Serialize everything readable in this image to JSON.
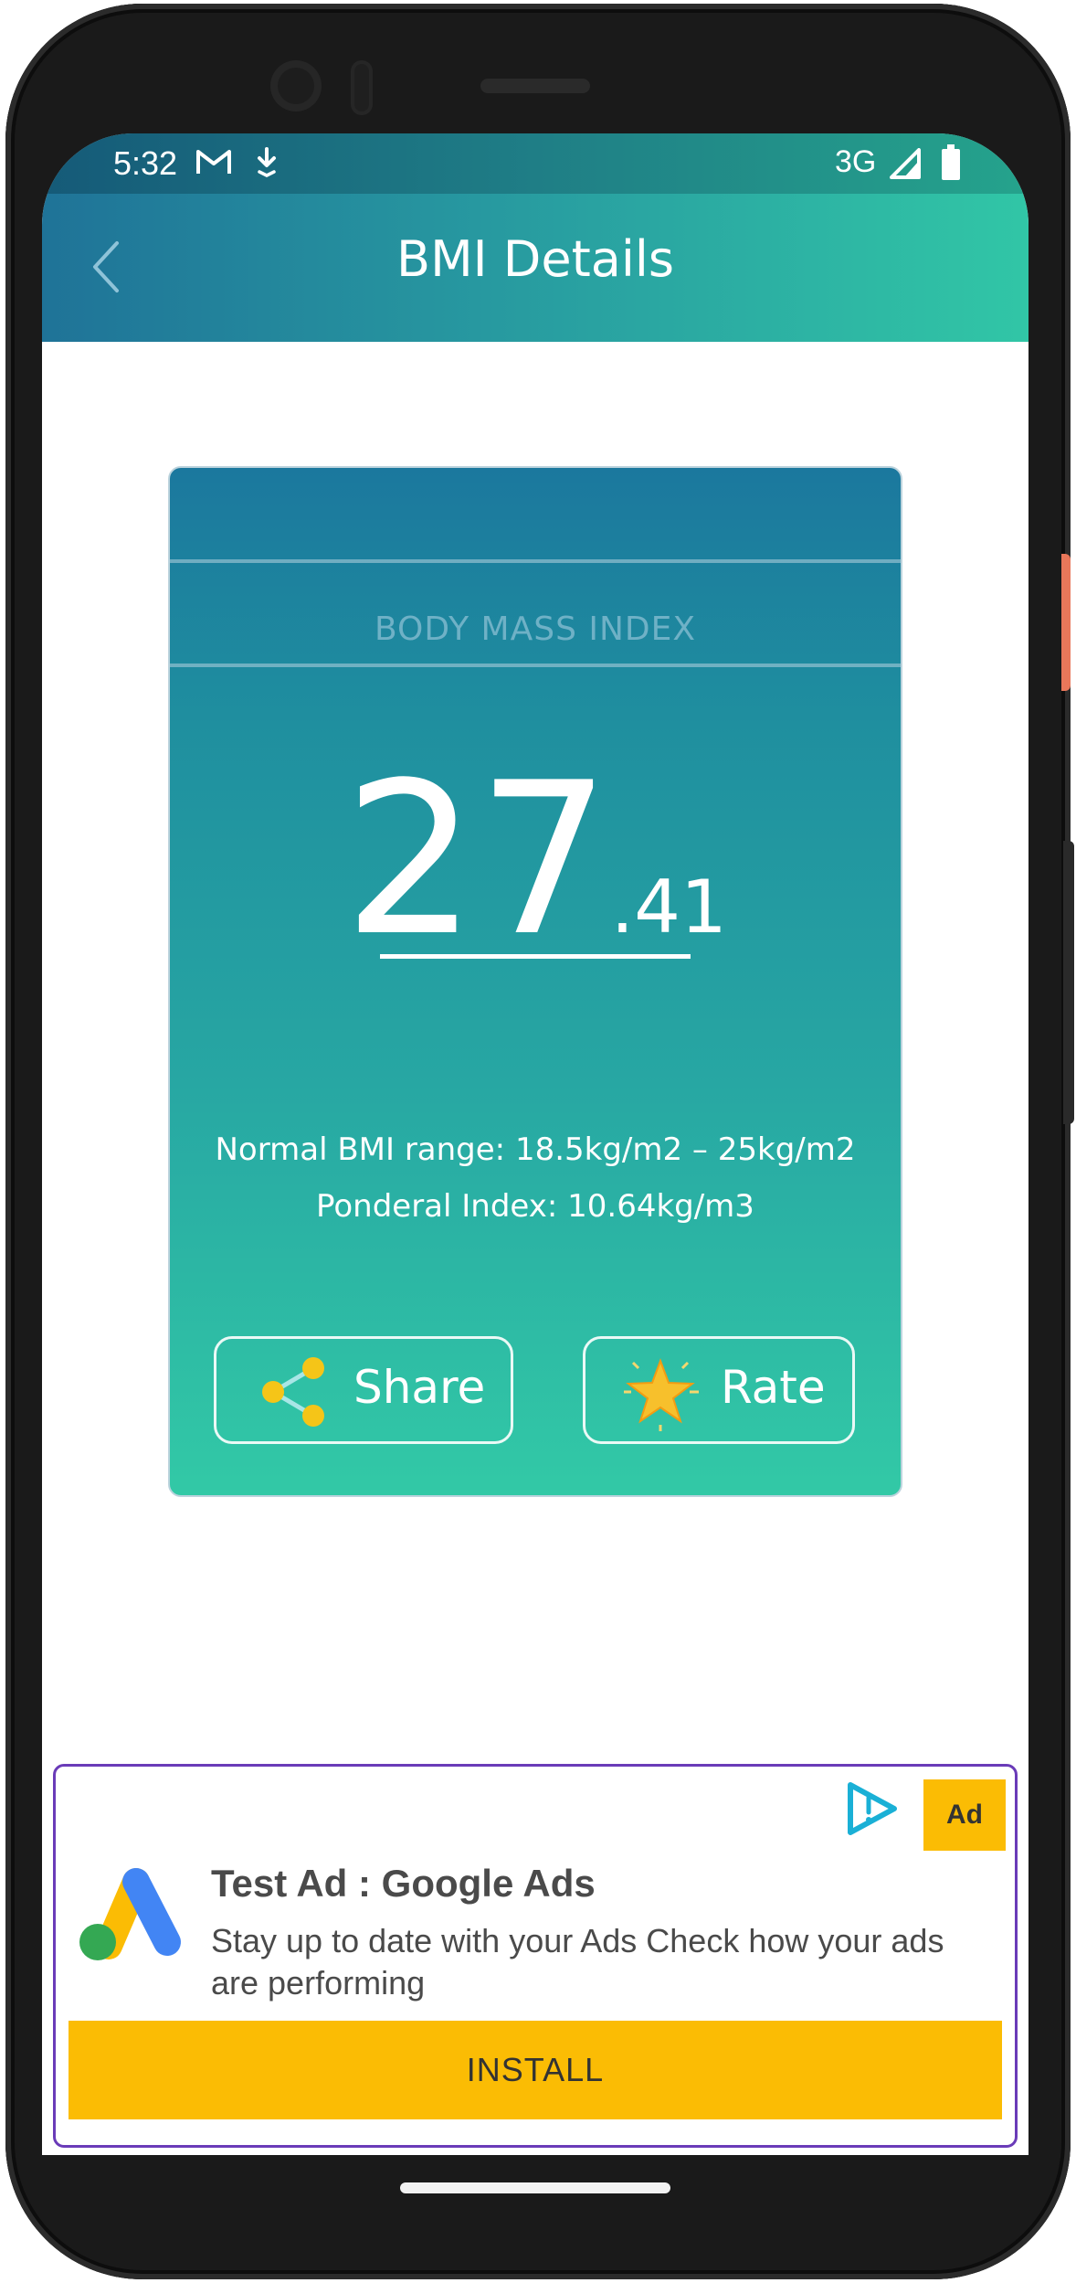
{
  "status_bar": {
    "time": "5:32",
    "network": "3G",
    "icons": [
      "gmail-icon",
      "download-icon",
      "signal-icon",
      "battery-icon"
    ]
  },
  "app_bar": {
    "title": "BMI Details",
    "back_icon": "chevron-left-icon"
  },
  "bmi_card": {
    "heading": "BODY MASS INDEX",
    "bmi_integer": "27",
    "bmi_decimal": ".41",
    "normal_range": "Normal BMI range: 18.5kg/m2 – 25kg/m2",
    "ponderal_index": "Ponderal Index: 10.64kg/m3",
    "share_label": "Share",
    "rate_label": "Rate",
    "share_icon": "share-icon",
    "rate_icon": "star-icon"
  },
  "ad": {
    "badge": "Ad",
    "title": "Test Ad : Google Ads",
    "description": "Stay up to date with your Ads Check how your ads are performing",
    "install_label": "INSTALL",
    "play_icon": "adchoices-play-icon",
    "logo": "google-ads-logo"
  },
  "colors": {
    "gradient_start": "#1f7398",
    "gradient_end": "#31c6a6",
    "ad_border": "#6a3bb8",
    "ad_yellow": "#fbbc04"
  }
}
